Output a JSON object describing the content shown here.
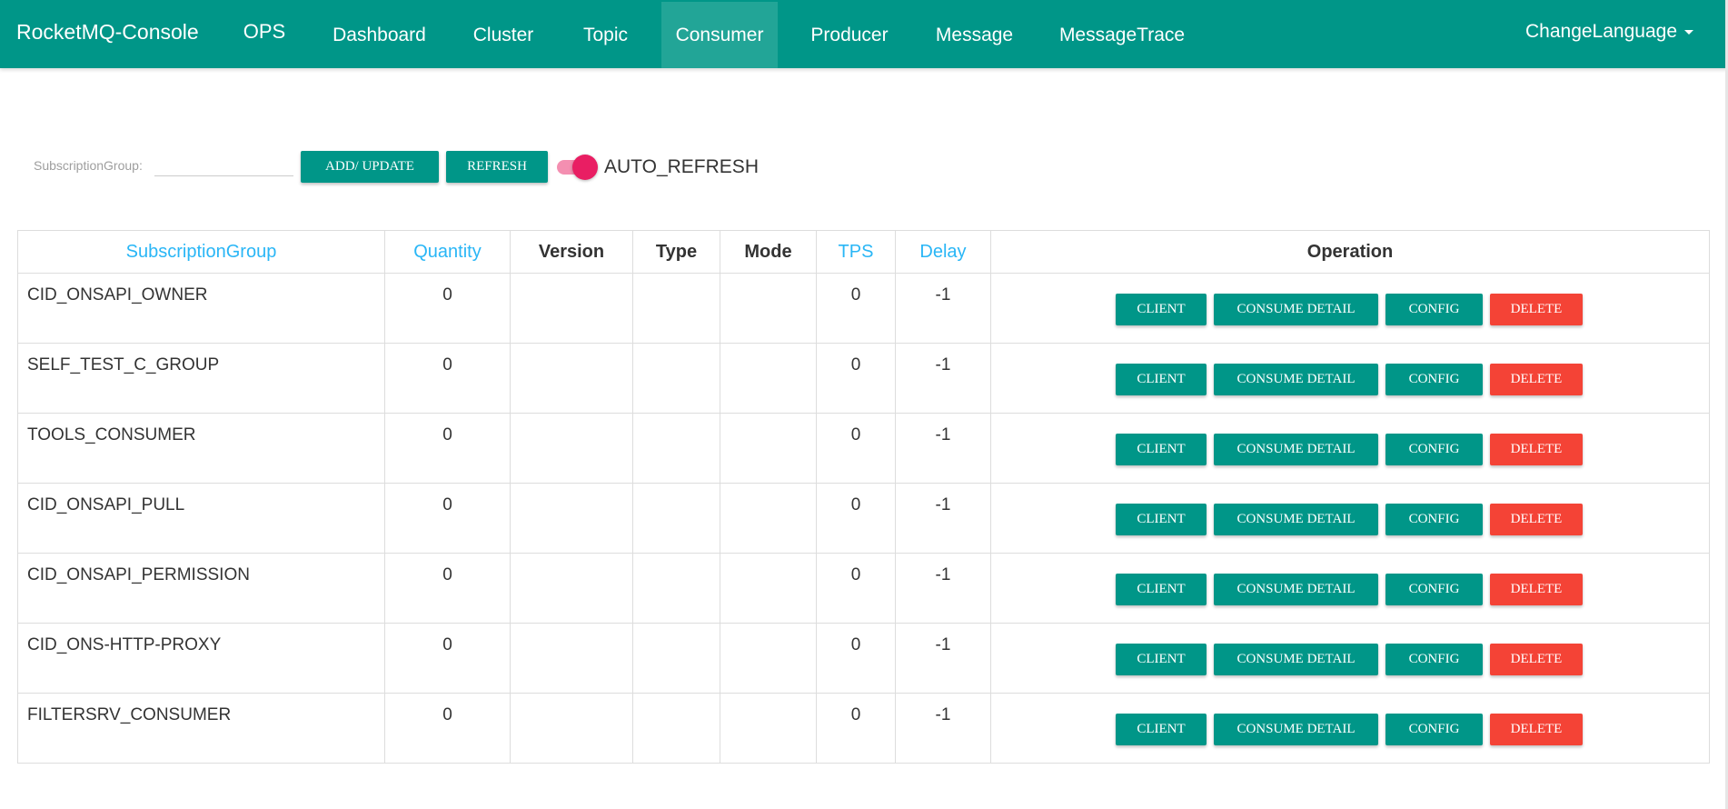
{
  "navbar": {
    "brand": "RocketMQ-Console",
    "items": [
      {
        "label": "OPS"
      },
      {
        "label": "Dashboard"
      },
      {
        "label": "Cluster"
      },
      {
        "label": "Topic"
      },
      {
        "label": "Consumer",
        "active": true
      },
      {
        "label": "Producer"
      },
      {
        "label": "Message"
      },
      {
        "label": "MessageTrace"
      }
    ],
    "language_label": "ChangeLanguage"
  },
  "toolbar": {
    "filter_label": "SubscriptionGroup:",
    "filter_value": "",
    "add_update_label": "ADD/ UPDATE",
    "refresh_label": "REFRESH",
    "auto_refresh_label": "AUTO_REFRESH",
    "auto_refresh_on": true
  },
  "table": {
    "columns": [
      {
        "label": "SubscriptionGroup",
        "sortable": true
      },
      {
        "label": "Quantity",
        "sortable": true
      },
      {
        "label": "Version",
        "sortable": false
      },
      {
        "label": "Type",
        "sortable": false
      },
      {
        "label": "Mode",
        "sortable": false
      },
      {
        "label": "TPS",
        "sortable": true
      },
      {
        "label": "Delay",
        "sortable": true
      },
      {
        "label": "Operation",
        "sortable": false
      }
    ],
    "action_labels": {
      "client": "CLIENT",
      "consume_detail": "CONSUME DETAIL",
      "config": "CONFIG",
      "delete": "DELETE"
    },
    "rows": [
      {
        "group": "CID_ONSAPI_OWNER",
        "quantity": "0",
        "version": "",
        "type": "",
        "mode": "",
        "tps": "0",
        "delay": "-1"
      },
      {
        "group": "SELF_TEST_C_GROUP",
        "quantity": "0",
        "version": "",
        "type": "",
        "mode": "",
        "tps": "0",
        "delay": "-1"
      },
      {
        "group": "TOOLS_CONSUMER",
        "quantity": "0",
        "version": "",
        "type": "",
        "mode": "",
        "tps": "0",
        "delay": "-1"
      },
      {
        "group": "CID_ONSAPI_PULL",
        "quantity": "0",
        "version": "",
        "type": "",
        "mode": "",
        "tps": "0",
        "delay": "-1"
      },
      {
        "group": "CID_ONSAPI_PERMISSION",
        "quantity": "0",
        "version": "",
        "type": "",
        "mode": "",
        "tps": "0",
        "delay": "-1"
      },
      {
        "group": "CID_ONS-HTTP-PROXY",
        "quantity": "0",
        "version": "",
        "type": "",
        "mode": "",
        "tps": "0",
        "delay": "-1"
      },
      {
        "group": "FILTERSRV_CONSUMER",
        "quantity": "0",
        "version": "",
        "type": "",
        "mode": "",
        "tps": "0",
        "delay": "-1"
      }
    ]
  },
  "colors": {
    "primary": "#009688",
    "primary_active": "#22a597",
    "danger": "#f44336",
    "link": "#29b6f6",
    "toggle": "#e91e63"
  }
}
